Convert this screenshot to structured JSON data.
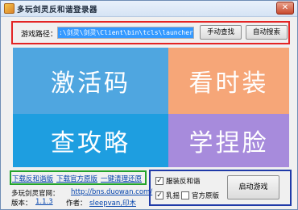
{
  "window": {
    "title": "多玩剑灵反和谐登录器",
    "close_glyph": "✕"
  },
  "path": {
    "label": "游戏路径：",
    "value": ":\\剑灵\\剑灵\\Client\\bin\\tcls\\launcher.exe",
    "find_button": "手动查找",
    "auto_button": "自动搜索"
  },
  "tiles": {
    "activate": "激活码",
    "skins": "看时装",
    "guide": "查攻略",
    "face": "学捏脸"
  },
  "links": {
    "download_patch": "下载反和谐版",
    "download_official": "下载官方原版",
    "one_click_restore": "一键清理还原"
  },
  "info": {
    "site_label": "多玩剑灵官网：",
    "site_url": "http://bns.duowan.com/",
    "version_label": "版本：",
    "version_value": "1.1.3",
    "author_label": "作者：",
    "author_value": "sleepvan,印木"
  },
  "options": {
    "clothes_patch": {
      "label": "服装反和谐",
      "checked": true
    },
    "boobs": {
      "label": "乳摇",
      "checked": true
    },
    "official_original": {
      "label": "官方原版",
      "checked": false
    },
    "launch_button": "启动游戏"
  },
  "colors": {
    "frame_red": "#e32424",
    "frame_green": "#22a32a",
    "frame_blue": "#1f3aa8",
    "tile_activate": "#4fa6e0",
    "tile_skins": "#f6a678",
    "tile_guide": "#1e9ee0",
    "tile_face": "#a78bdc"
  }
}
